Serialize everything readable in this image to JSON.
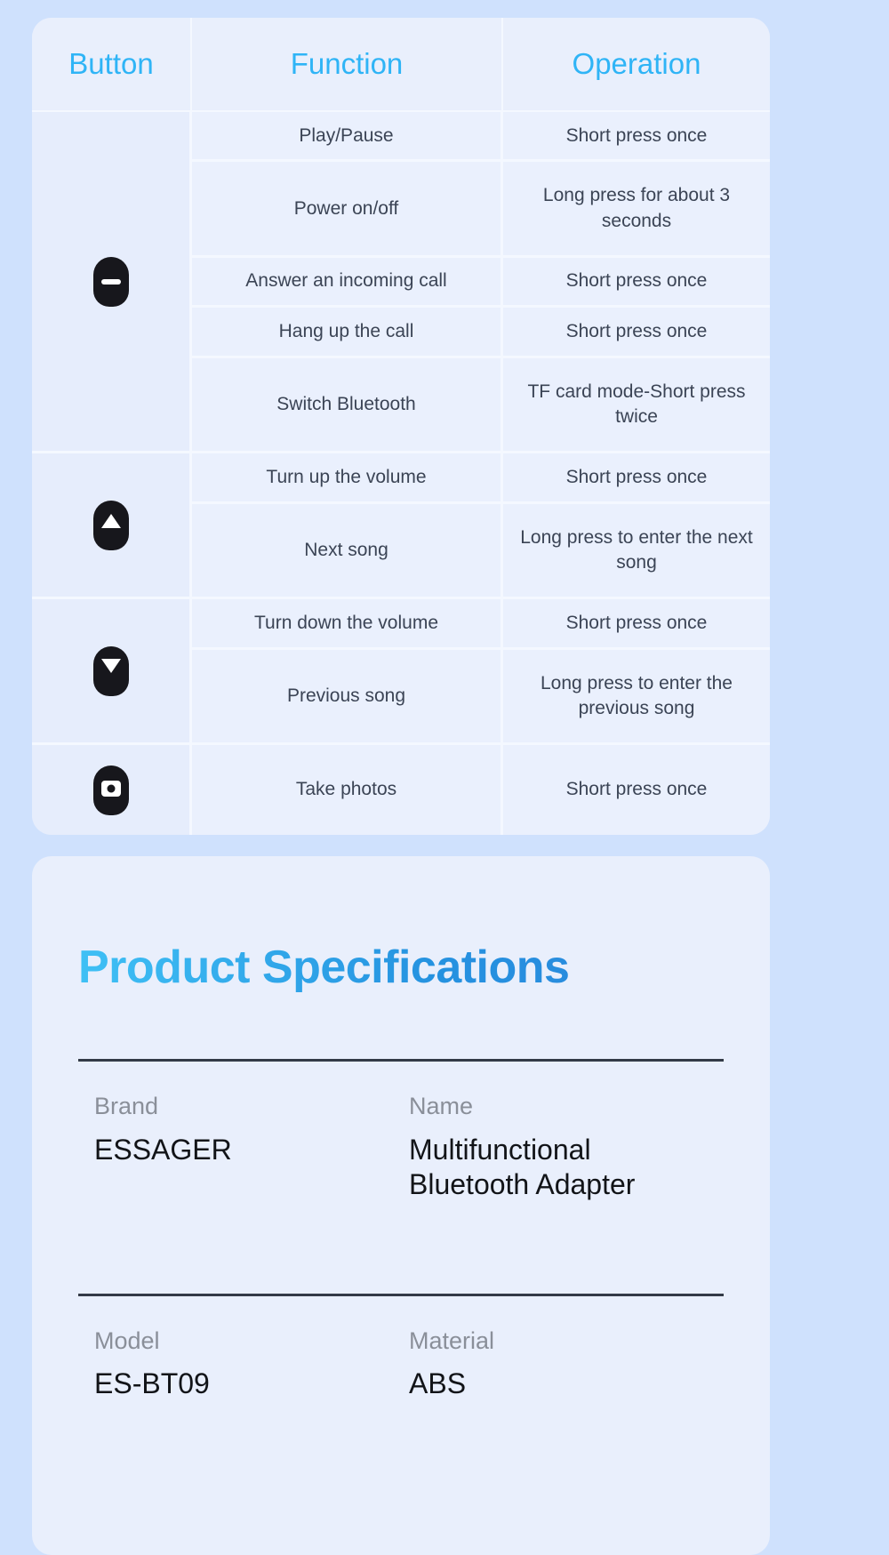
{
  "theme": {
    "page_bg": "#cfe1fd",
    "card_bg": "#e9effc",
    "header_accent": "#2fb4f6",
    "title_gradient_from": "#3fc0f5",
    "title_gradient_to": "#2b86dc",
    "body_text": "#3b4455",
    "label_text": "#8a8f99",
    "icon_black": "#17171c"
  },
  "operation_table": {
    "columns": [
      {
        "label": "Button"
      },
      {
        "label": "Function"
      },
      {
        "label": "Operation"
      }
    ],
    "groups": [
      {
        "icon": "multifunction-button-icon",
        "icon_glyph": "minus",
        "rows": [
          {
            "function": "Play/Pause",
            "operation": "Short press once"
          },
          {
            "function": "Power on/off",
            "operation": "Long press for about 3 seconds"
          },
          {
            "function": "Answer an incoming call",
            "operation": "Short press once"
          },
          {
            "function": "Hang up the call",
            "operation": "Short press once"
          },
          {
            "function": "Switch Bluetooth",
            "operation": "TF card mode-Short press twice"
          }
        ]
      },
      {
        "icon": "volume-up-button-icon",
        "icon_glyph": "up",
        "rows": [
          {
            "function": "Turn up the volume",
            "operation": "Short press once"
          },
          {
            "function": "Next song",
            "operation": "Long press to enter the next song"
          }
        ]
      },
      {
        "icon": "volume-down-button-icon",
        "icon_glyph": "down",
        "rows": [
          {
            "function": "Turn down the volume",
            "operation": "Short press once"
          },
          {
            "function": "Previous song",
            "operation": "Long press to enter the previous song"
          }
        ]
      },
      {
        "icon": "camera-button-icon",
        "icon_glyph": "camera",
        "rows": [
          {
            "function": "Take photos",
            "operation": "Short press once"
          }
        ]
      }
    ]
  },
  "specifications": {
    "title": "Product Specifications",
    "rows": [
      [
        {
          "label": "Brand",
          "value": "ESSAGER"
        },
        {
          "label": "Name",
          "value": "Multifunctional Bluetooth Adapter"
        }
      ],
      [
        {
          "label": "Model",
          "value": "ES-BT09"
        },
        {
          "label": "Material",
          "value": "ABS"
        }
      ]
    ]
  }
}
